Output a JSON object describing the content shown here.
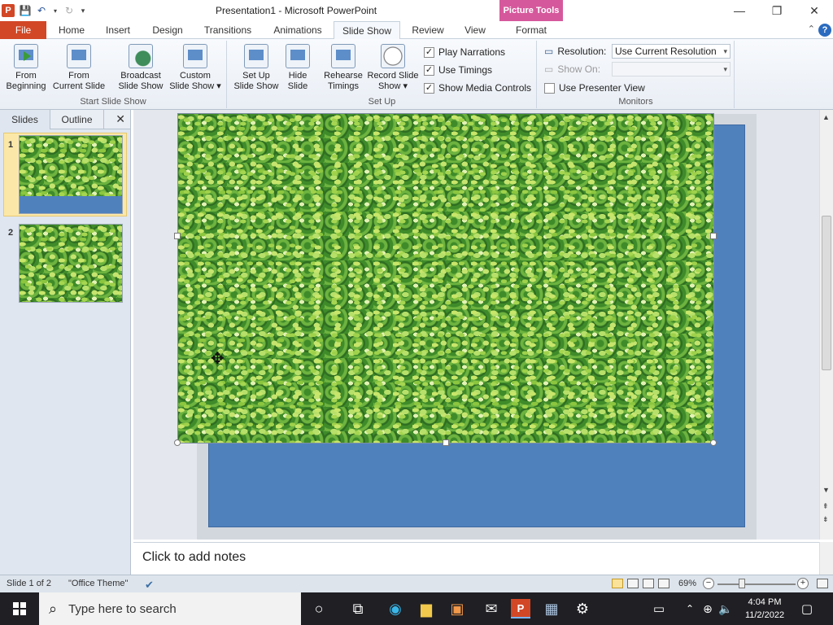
{
  "window": {
    "title": "Presentation1  -  Microsoft PowerPoint",
    "context_tab": "Picture Tools",
    "controls": [
      "—",
      "❐",
      "✕"
    ]
  },
  "tabs": [
    "File",
    "Home",
    "Insert",
    "Design",
    "Transitions",
    "Animations",
    "Slide Show",
    "Review",
    "View",
    "Format"
  ],
  "ribbon": {
    "start_group": {
      "label": "Start Slide Show",
      "from_beginning": [
        "From",
        "Beginning"
      ],
      "from_current": [
        "From",
        "Current Slide"
      ],
      "broadcast": [
        "Broadcast",
        "Slide Show"
      ],
      "custom": [
        "Custom",
        "Slide Show ▾"
      ]
    },
    "setup_group": {
      "label": "Set Up",
      "setup": [
        "Set Up",
        "Slide Show"
      ],
      "hide": [
        "Hide",
        "Slide"
      ],
      "rehearse": [
        "Rehearse",
        "Timings"
      ],
      "record": [
        "Record Slide",
        "Show ▾"
      ],
      "play_narrations": "Play Narrations",
      "use_timings": "Use Timings",
      "show_media": "Show Media Controls"
    },
    "monitors_group": {
      "label": "Monitors",
      "resolution_label": "Resolution:",
      "resolution_value": "Use Current Resolution",
      "show_on_label": "Show On:",
      "show_on_value": "",
      "presenter_view": "Use Presenter View"
    }
  },
  "left_pane": {
    "tabs": [
      "Slides",
      "Outline"
    ],
    "close": "✕",
    "slides": [
      {
        "num": "1"
      },
      {
        "num": "2"
      }
    ]
  },
  "notes": {
    "placeholder": "Click to add notes"
  },
  "status": {
    "slide": "Slide 1 of 2",
    "theme": "\"Office Theme\"",
    "zoom": "69%"
  },
  "taskbar": {
    "search_placeholder": "Type here to search",
    "time": "4:04 PM",
    "date": "11/2/2022"
  },
  "colors": {
    "file_tab": "#d24726",
    "slide_blue": "#4f81bd",
    "context_tab": "#d6589c"
  }
}
